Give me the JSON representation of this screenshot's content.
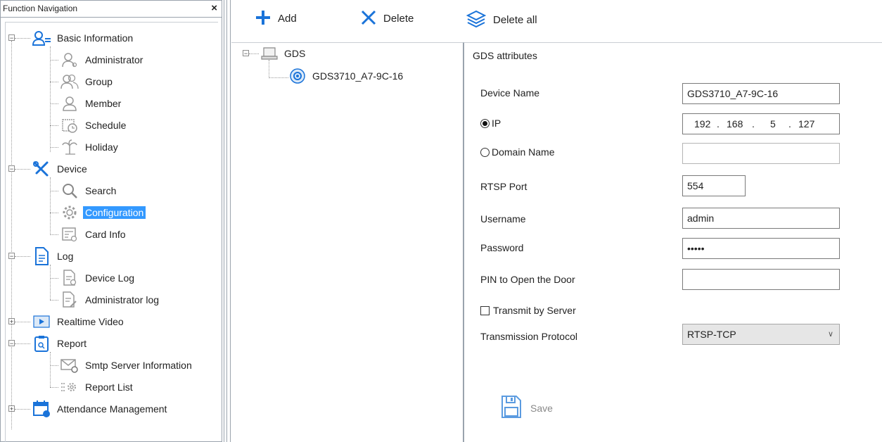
{
  "nav": {
    "title": "Function Navigation",
    "close_glyph": "×",
    "items": [
      {
        "label": "Basic Information",
        "icon": "user-list-icon"
      },
      {
        "label": "Administrator",
        "icon": "admin-user-icon"
      },
      {
        "label": "Group",
        "icon": "group-icon"
      },
      {
        "label": "Member",
        "icon": "member-icon"
      },
      {
        "label": "Schedule",
        "icon": "schedule-icon"
      },
      {
        "label": "Holiday",
        "icon": "holiday-icon"
      },
      {
        "label": "Device",
        "icon": "tools-icon"
      },
      {
        "label": "Search",
        "icon": "search-icon"
      },
      {
        "label": "Configuration",
        "icon": "gear-icon"
      },
      {
        "label": "Card Info",
        "icon": "card-info-icon"
      },
      {
        "label": "Log",
        "icon": "log-document-icon"
      },
      {
        "label": "Device Log",
        "icon": "device-log-icon"
      },
      {
        "label": "Administrator log",
        "icon": "admin-log-icon"
      },
      {
        "label": "Realtime Video",
        "icon": "play-icon"
      },
      {
        "label": "Report",
        "icon": "report-icon"
      },
      {
        "label": "Smtp Server Information",
        "icon": "mail-icon"
      },
      {
        "label": "Report List",
        "icon": "report-list-icon"
      },
      {
        "label": "Attendance Management",
        "icon": "calendar-icon"
      }
    ],
    "expander_minus": "−",
    "expander_plus": "+"
  },
  "toolbar": {
    "add_label": "Add",
    "delete_label": "Delete",
    "delete_all_label": "Delete all"
  },
  "device_tree": {
    "root_label": "GDS",
    "child_label": "GDS3710_A7-9C-16"
  },
  "attributes": {
    "section_title": "GDS attributes",
    "device_name_label": "Device Name",
    "device_name_value": "GDS3710_A7-9C-16",
    "ip_label": "IP",
    "ip_octets": [
      "192",
      "168",
      "5",
      "127"
    ],
    "ip_dot": ".",
    "domain_label": "Domain Name",
    "domain_value": "",
    "rtsp_port_label": "RTSP Port",
    "rtsp_port_value": "554",
    "username_label": "Username",
    "username_value": "admin",
    "password_label": "Password",
    "password_value": "•••••",
    "pin_label": "PIN to Open the Door",
    "pin_value": "",
    "transmit_label": "Transmit by Server",
    "protocol_label": "Transmission Protocol",
    "protocol_value": "RTSP-TCP",
    "save_label": "Save"
  },
  "colors": {
    "selection": "#3399ff",
    "icon_blue": "#1a73d9",
    "border": "#9aa3ad"
  }
}
